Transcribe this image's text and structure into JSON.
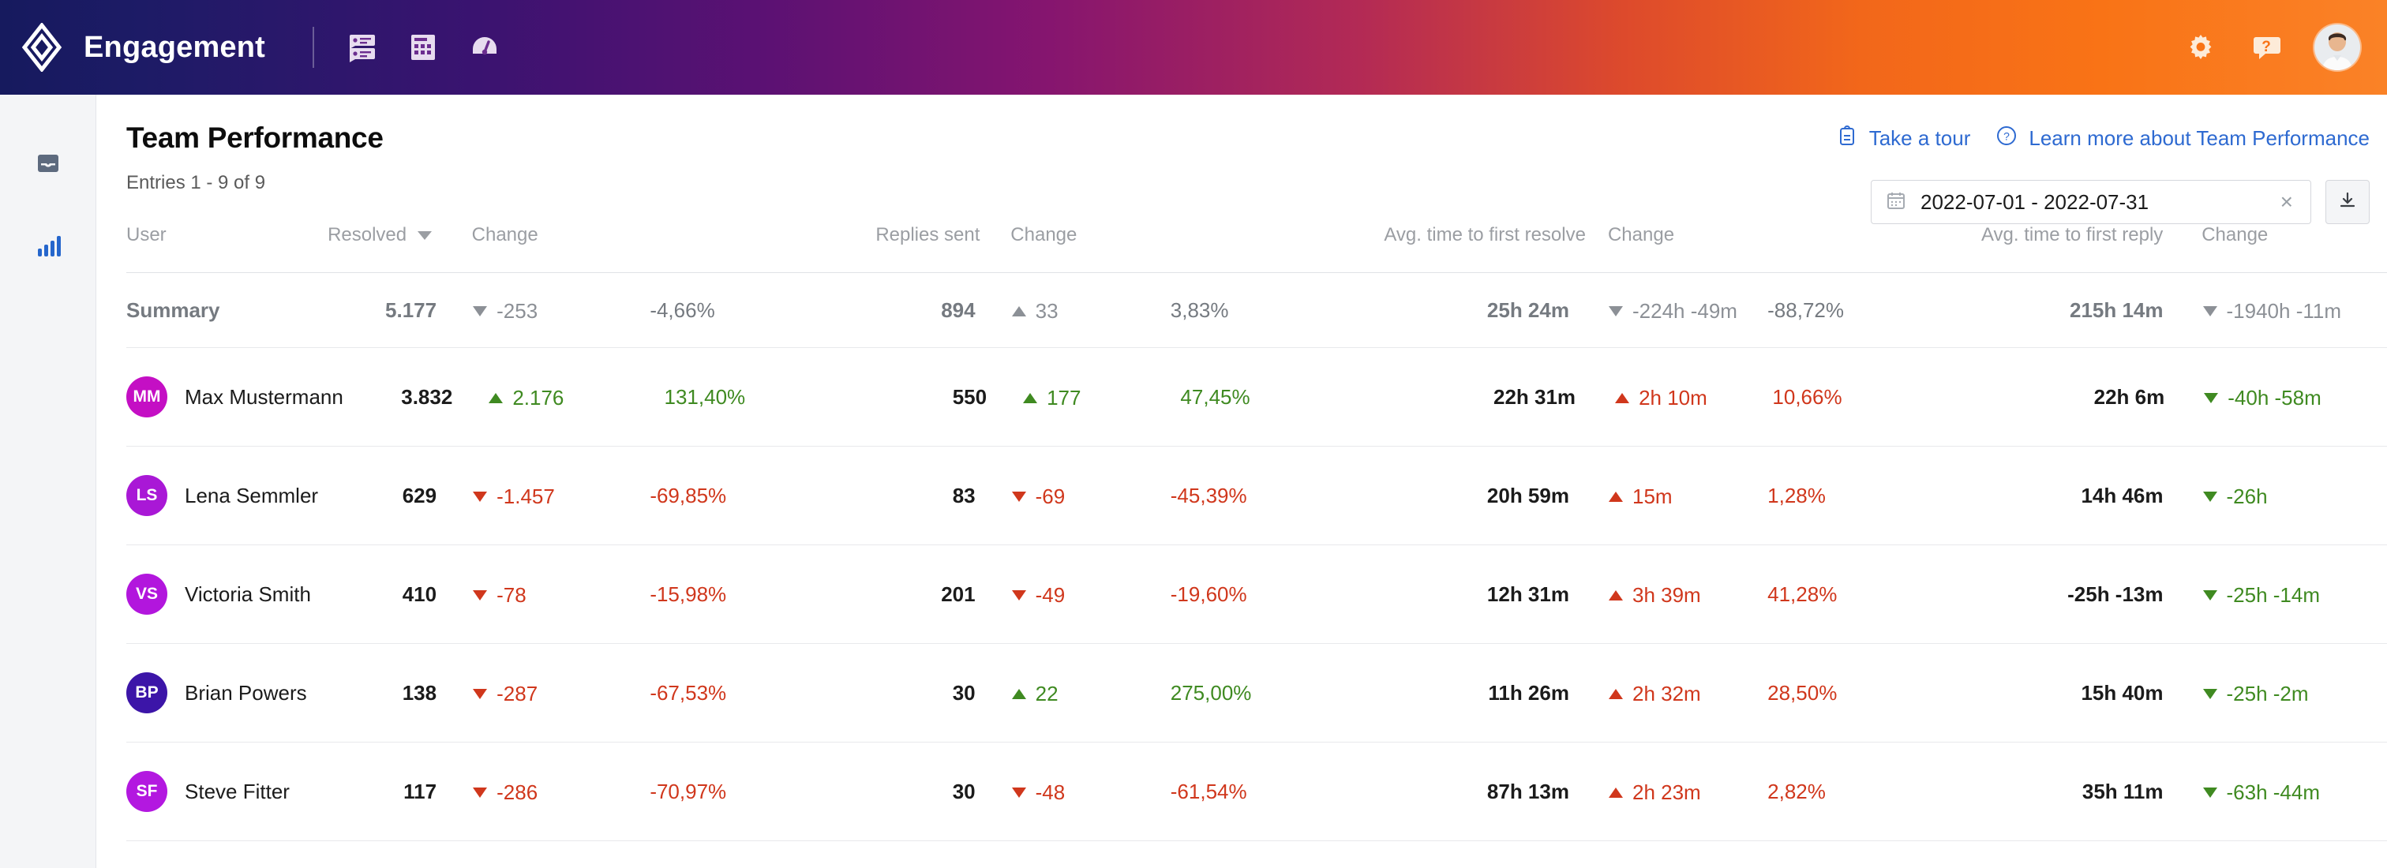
{
  "topbar": {
    "brand_title": "Engagement",
    "logo_icon": "diamond-logo-icon",
    "apps": [
      {
        "icon": "conversations-icon",
        "name": "app-conversations"
      },
      {
        "icon": "grid-apps-icon",
        "name": "app-grid"
      },
      {
        "icon": "speedometer-icon",
        "name": "app-performance"
      }
    ],
    "settings_icon": "gear-icon",
    "help_icon": "question-bubble-icon",
    "avatar_icon": "user-avatar"
  },
  "sidebar": {
    "items": [
      {
        "icon": "inbox-icon",
        "name": "sidebar-item-inbox",
        "active": false
      },
      {
        "icon": "bar-chart-icon",
        "name": "sidebar-item-reports",
        "active": true
      }
    ]
  },
  "page": {
    "title": "Team Performance",
    "entries": "Entries 1 - 9 of 9",
    "take_a_tour": "Take a tour",
    "learn_more": "Learn more about Team Performance",
    "tour_icon": "clipboard-icon",
    "learn_icon": "question-circle-icon"
  },
  "controls": {
    "calendar_icon": "calendar-icon",
    "date_range": "2022-07-01 - 2022-07-31",
    "clear_label": "×",
    "download_icon": "download-icon"
  },
  "colors": {
    "positive": "#3f8a21",
    "negative": "#d0371c",
    "neutral": "#8c9096",
    "link": "#2e6ad1"
  },
  "table": {
    "headers": {
      "user": "User",
      "resolved": "Resolved",
      "change1": "Change",
      "replies_sent": "Replies sent",
      "change2": "Change",
      "avg_first_resolve": "Avg. time to first resolve",
      "change3": "Change",
      "avg_first_reply": "Avg. time to first reply",
      "change4": "Change"
    },
    "sort": {
      "column": "Resolved",
      "direction": "desc",
      "icon": "caret-down-icon"
    },
    "summary": {
      "name": "Summary",
      "resolved": "5.177",
      "resolved_delta": "-253",
      "resolved_delta_dir": "down",
      "resolved_delta_tone": "neutral",
      "resolved_pct": "-4,66%",
      "resolved_pct_tone": "neutral",
      "replies": "894",
      "replies_delta": "33",
      "replies_delta_dir": "up",
      "replies_delta_tone": "neutral",
      "replies_pct": "3,83%",
      "replies_pct_tone": "neutral",
      "first_resolve": "25h 24m",
      "first_resolve_delta": "-224h -49m",
      "first_resolve_delta_dir": "down",
      "first_resolve_delta_tone": "neutral",
      "first_resolve_pct": "-88,72%",
      "first_resolve_pct_tone": "neutral",
      "first_reply": "215h 14m",
      "first_reply_delta": "-1940h -11m",
      "first_reply_delta_dir": "down",
      "first_reply_delta_tone": "neutral"
    },
    "rows": [
      {
        "initials": "MM",
        "avatar_color": "#c40fc4",
        "name": "Max Mustermann",
        "resolved": "3.832",
        "resolved_delta": "2.176",
        "resolved_delta_dir": "up",
        "resolved_delta_tone": "positive",
        "resolved_pct": "131,40%",
        "resolved_pct_tone": "positive",
        "replies": "550",
        "replies_delta": "177",
        "replies_delta_dir": "up",
        "replies_delta_tone": "positive",
        "replies_pct": "47,45%",
        "replies_pct_tone": "positive",
        "first_resolve": "22h 31m",
        "first_resolve_delta": "2h 10m",
        "first_resolve_delta_dir": "up",
        "first_resolve_delta_tone": "negative",
        "first_resolve_pct": "10,66%",
        "first_resolve_pct_tone": "negative",
        "first_reply": "22h 6m",
        "first_reply_delta": "-40h -58m",
        "first_reply_delta_dir": "down",
        "first_reply_delta_tone": "positive"
      },
      {
        "initials": "LS",
        "avatar_color": "#a918d6",
        "name": "Lena Semmler",
        "resolved": "629",
        "resolved_delta": "-1.457",
        "resolved_delta_dir": "down",
        "resolved_delta_tone": "negative",
        "resolved_pct": "-69,85%",
        "resolved_pct_tone": "negative",
        "replies": "83",
        "replies_delta": "-69",
        "replies_delta_dir": "down",
        "replies_delta_tone": "negative",
        "replies_pct": "-45,39%",
        "replies_pct_tone": "negative",
        "first_resolve": "20h 59m",
        "first_resolve_delta": "15m",
        "first_resolve_delta_dir": "up",
        "first_resolve_delta_tone": "negative",
        "first_resolve_pct": "1,28%",
        "first_resolve_pct_tone": "negative",
        "first_reply": "14h 46m",
        "first_reply_delta": "-26h",
        "first_reply_delta_dir": "down",
        "first_reply_delta_tone": "positive"
      },
      {
        "initials": "VS",
        "avatar_color": "#b216dd",
        "name": "Victoria Smith",
        "resolved": "410",
        "resolved_delta": "-78",
        "resolved_delta_dir": "down",
        "resolved_delta_tone": "negative",
        "resolved_pct": "-15,98%",
        "resolved_pct_tone": "negative",
        "replies": "201",
        "replies_delta": "-49",
        "replies_delta_dir": "down",
        "replies_delta_tone": "negative",
        "replies_pct": "-19,60%",
        "replies_pct_tone": "negative",
        "first_resolve": "12h 31m",
        "first_resolve_delta": "3h 39m",
        "first_resolve_delta_dir": "up",
        "first_resolve_delta_tone": "negative",
        "first_resolve_pct": "41,28%",
        "first_resolve_pct_tone": "negative",
        "first_reply": "-25h -13m",
        "first_reply_delta": "-25h -14m",
        "first_reply_delta_dir": "down",
        "first_reply_delta_tone": "positive"
      },
      {
        "initials": "BP",
        "avatar_color": "#3c15a8",
        "name": "Brian Powers",
        "resolved": "138",
        "resolved_delta": "-287",
        "resolved_delta_dir": "down",
        "resolved_delta_tone": "negative",
        "resolved_pct": "-67,53%",
        "resolved_pct_tone": "negative",
        "replies": "30",
        "replies_delta": "22",
        "replies_delta_dir": "up",
        "replies_delta_tone": "positive",
        "replies_pct": "275,00%",
        "replies_pct_tone": "positive",
        "first_resolve": "11h 26m",
        "first_resolve_delta": "2h 32m",
        "first_resolve_delta_dir": "up",
        "first_resolve_delta_tone": "negative",
        "first_resolve_pct": "28,50%",
        "first_resolve_pct_tone": "negative",
        "first_reply": "15h 40m",
        "first_reply_delta": "-25h -2m",
        "first_reply_delta_dir": "down",
        "first_reply_delta_tone": "positive"
      },
      {
        "initials": "SF",
        "avatar_color": "#b318e0",
        "name": "Steve Fitter",
        "resolved": "117",
        "resolved_delta": "-286",
        "resolved_delta_dir": "down",
        "resolved_delta_tone": "negative",
        "resolved_pct": "-70,97%",
        "resolved_pct_tone": "negative",
        "replies": "30",
        "replies_delta": "-48",
        "replies_delta_dir": "down",
        "replies_delta_tone": "negative",
        "replies_pct": "-61,54%",
        "replies_pct_tone": "negative",
        "first_resolve": "87h 13m",
        "first_resolve_delta": "2h 23m",
        "first_resolve_delta_dir": "up",
        "first_resolve_delta_tone": "negative",
        "first_resolve_pct": "2,82%",
        "first_resolve_pct_tone": "negative",
        "first_reply": "35h 11m",
        "first_reply_delta": "-63h -44m",
        "first_reply_delta_dir": "down",
        "first_reply_delta_tone": "positive"
      }
    ]
  }
}
